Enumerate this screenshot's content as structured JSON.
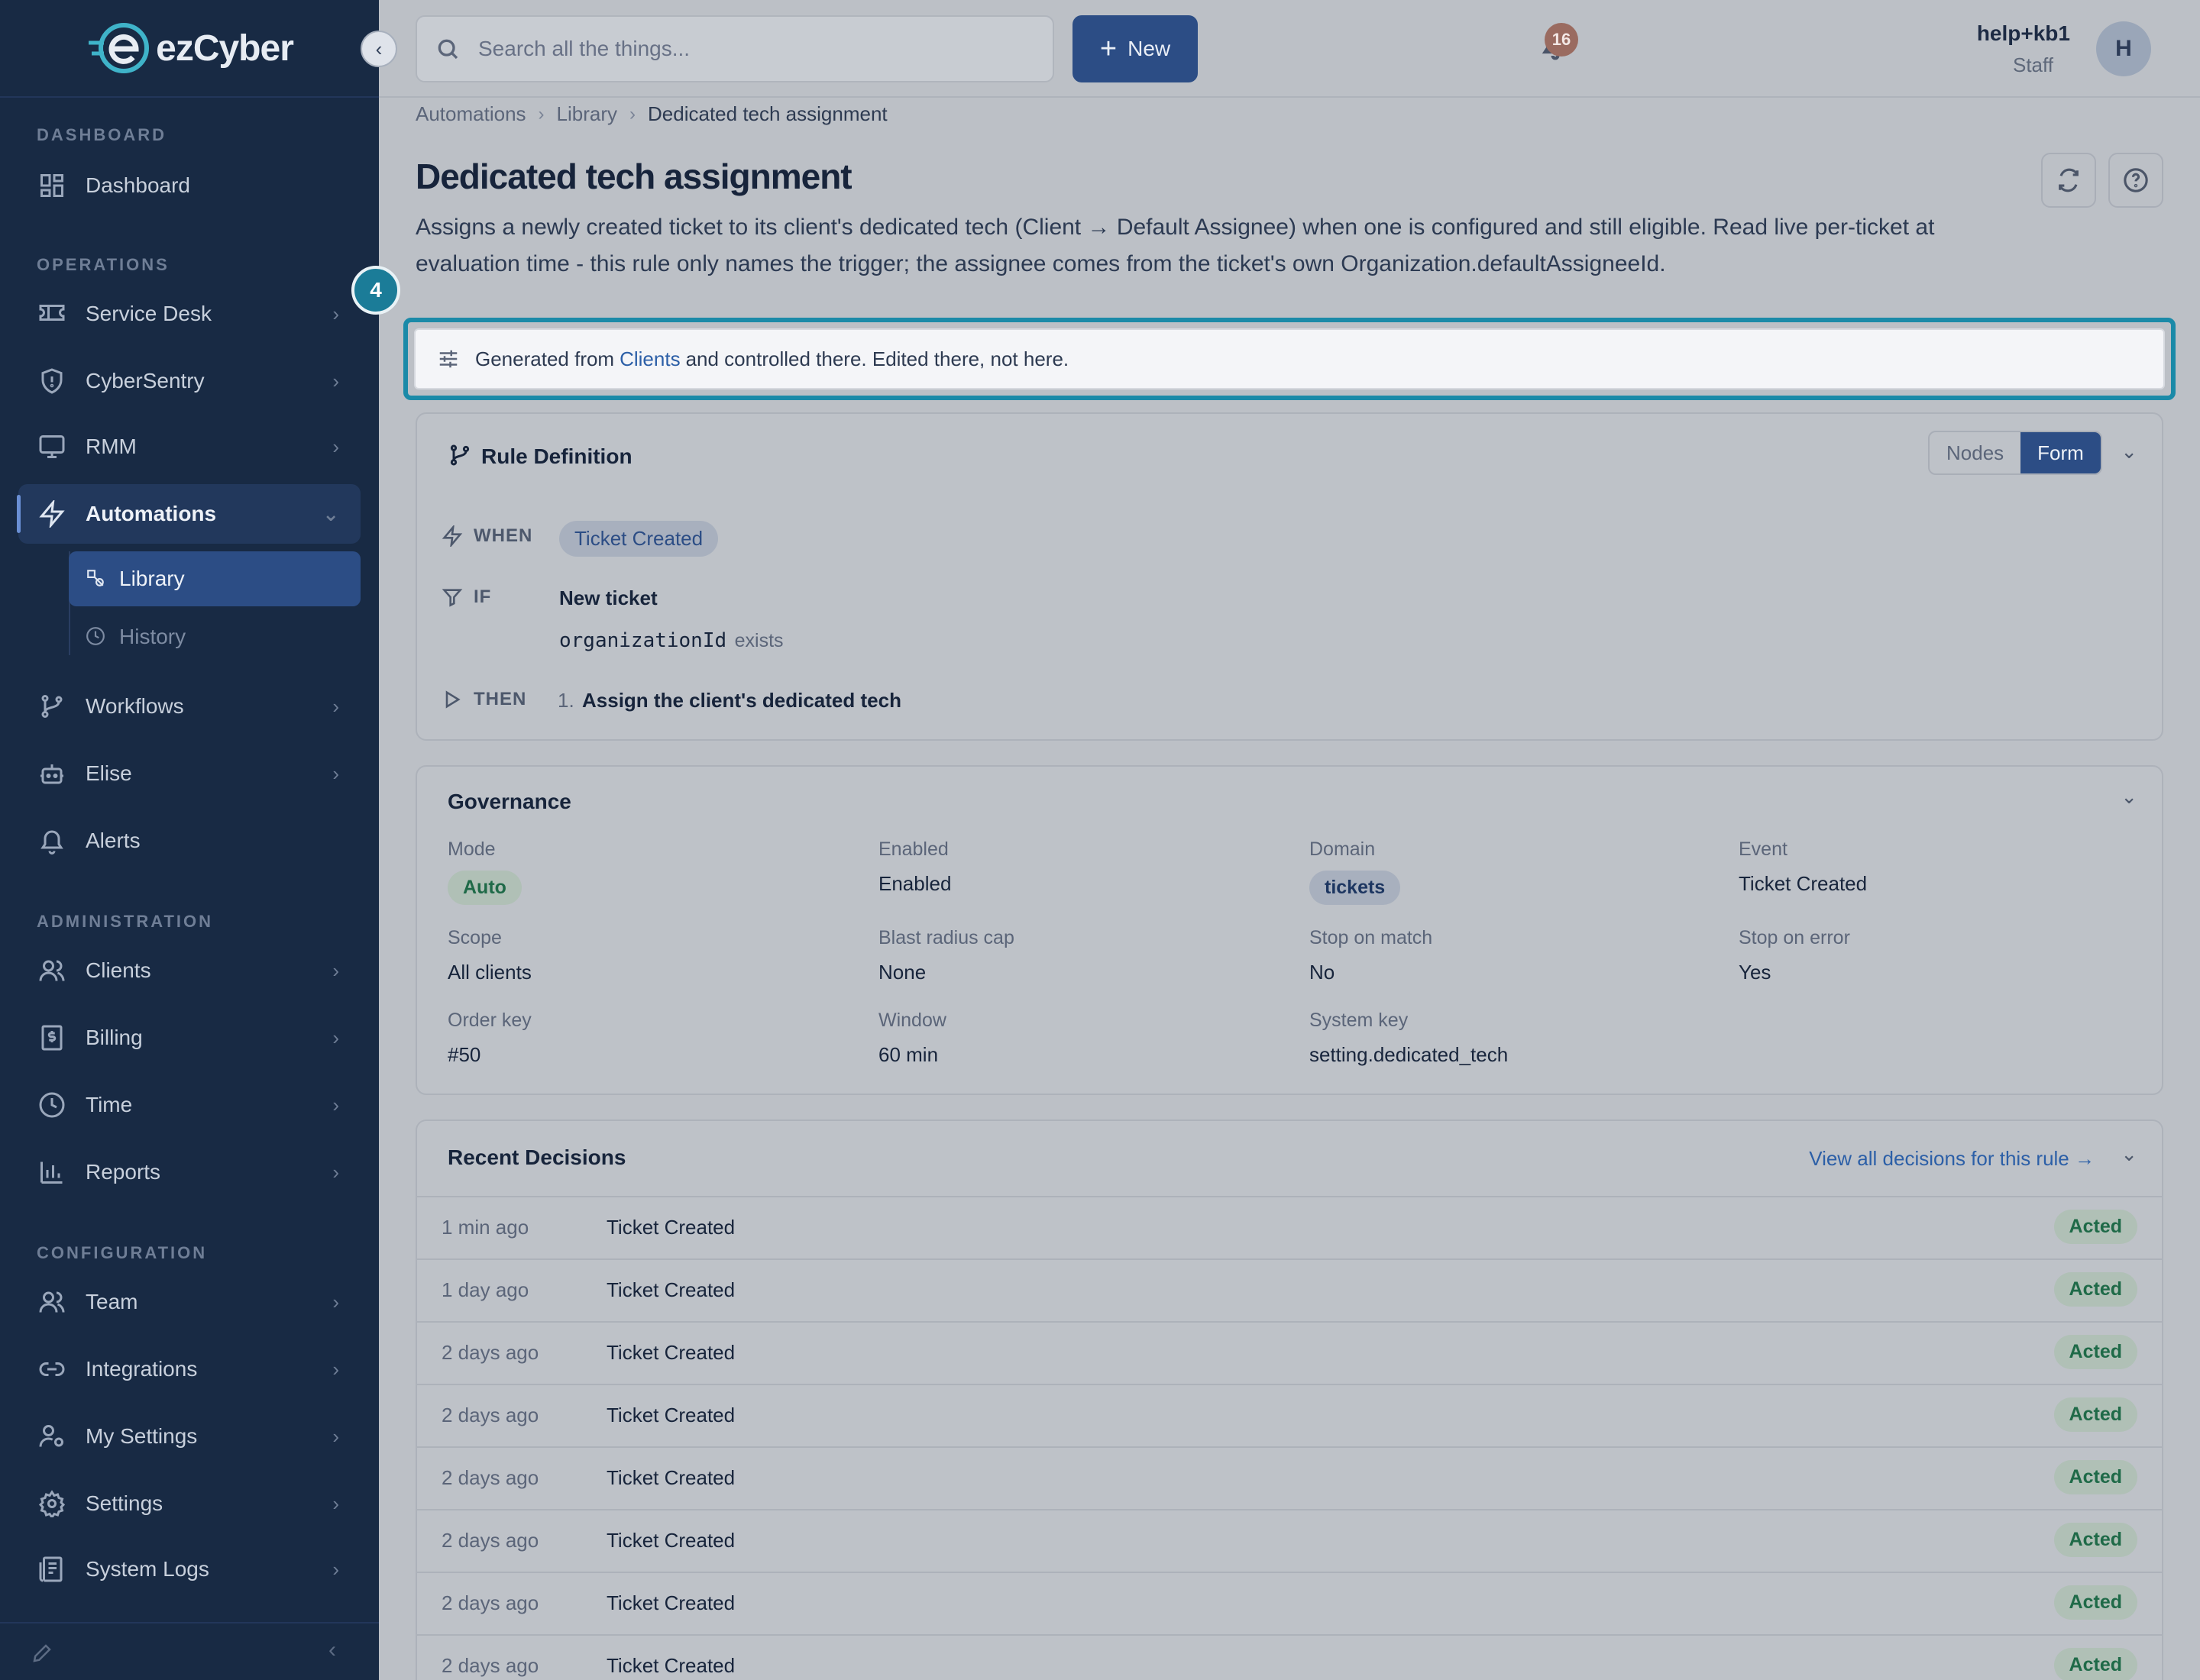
{
  "brand": {
    "name": "ezCyber",
    "colors": {
      "sidebar": "#182a44",
      "accent": "#2c4d85",
      "highlight": "#1b8aa8",
      "success": "#1f6a48"
    }
  },
  "sidebar": {
    "sections": {
      "dashboard": "DASHBOARD",
      "operations": "OPERATIONS",
      "administration": "ADMINISTRATION",
      "configuration": "CONFIGURATION"
    },
    "items": {
      "dashboard": "Dashboard",
      "service_desk": "Service Desk",
      "cybersentry": "CyberSentry",
      "rmm": "RMM",
      "automations": "Automations",
      "library": "Library",
      "history": "History",
      "workflows": "Workflows",
      "elise": "Elise",
      "alerts": "Alerts",
      "clients": "Clients",
      "billing": "Billing",
      "time": "Time",
      "reports": "Reports",
      "team": "Team",
      "integrations": "Integrations",
      "my_settings": "My Settings",
      "settings": "Settings",
      "system_logs": "System Logs"
    }
  },
  "topbar": {
    "search_placeholder": "Search all the things...",
    "new_label": "New",
    "notifications_count": "16",
    "user_name": "help+kb1",
    "user_role": "Staff",
    "avatar_initial": "H"
  },
  "breadcrumb": {
    "level1": "Automations",
    "level2": "Library",
    "current": "Dedicated tech assignment"
  },
  "page": {
    "title": "Dedicated tech assignment",
    "description": "Assigns a newly created ticket to its client's dedicated tech (Client → Default Assignee) when one is configured and still eligible. Read live per-ticket at evaluation time - this rule only names the trigger; the assignee comes from the ticket's own Organization.defaultAssigneeId.",
    "step_number": "4"
  },
  "notice": {
    "prefix": "Generated from",
    "link": "Clients",
    "suffix": "and controlled there. Edited there, not here."
  },
  "rule_definition": {
    "title": "Rule Definition",
    "toggle_nodes": "Nodes",
    "toggle_form": "Form",
    "when_label": "WHEN",
    "when_value": "Ticket Created",
    "if_label": "IF",
    "if_title": "New ticket",
    "if_field": "organizationId",
    "if_op": "exists",
    "then_label": "THEN",
    "then_index": "1.",
    "then_action": "Assign the client's dedicated tech"
  },
  "governance": {
    "title": "Governance",
    "mode_label": "Mode",
    "mode_value": "Auto",
    "enabled_label": "Enabled",
    "enabled_value": "Enabled",
    "domain_label": "Domain",
    "domain_value": "tickets",
    "event_label": "Event",
    "event_value": "Ticket Created",
    "scope_label": "Scope",
    "scope_value": "All clients",
    "blast_label": "Blast radius cap",
    "blast_value": "None",
    "stop_match_label": "Stop on match",
    "stop_match_value": "No",
    "stop_error_label": "Stop on error",
    "stop_error_value": "Yes",
    "order_label": "Order key",
    "order_value": "#50",
    "window_label": "Window",
    "window_value": "60 min",
    "system_label": "System key",
    "system_value": "setting.dedicated_tech"
  },
  "recent_decisions": {
    "title": "Recent Decisions",
    "view_all": "View all decisions for this rule →",
    "rows": [
      {
        "when": "1 min ago",
        "event": "Ticket Created",
        "result": "Acted"
      },
      {
        "when": "1 day ago",
        "event": "Ticket Created",
        "result": "Acted"
      },
      {
        "when": "2 days ago",
        "event": "Ticket Created",
        "result": "Acted"
      },
      {
        "when": "2 days ago",
        "event": "Ticket Created",
        "result": "Acted"
      },
      {
        "when": "2 days ago",
        "event": "Ticket Created",
        "result": "Acted"
      },
      {
        "when": "2 days ago",
        "event": "Ticket Created",
        "result": "Acted"
      },
      {
        "when": "2 days ago",
        "event": "Ticket Created",
        "result": "Acted"
      },
      {
        "when": "2 days ago",
        "event": "Ticket Created",
        "result": "Acted"
      }
    ]
  }
}
